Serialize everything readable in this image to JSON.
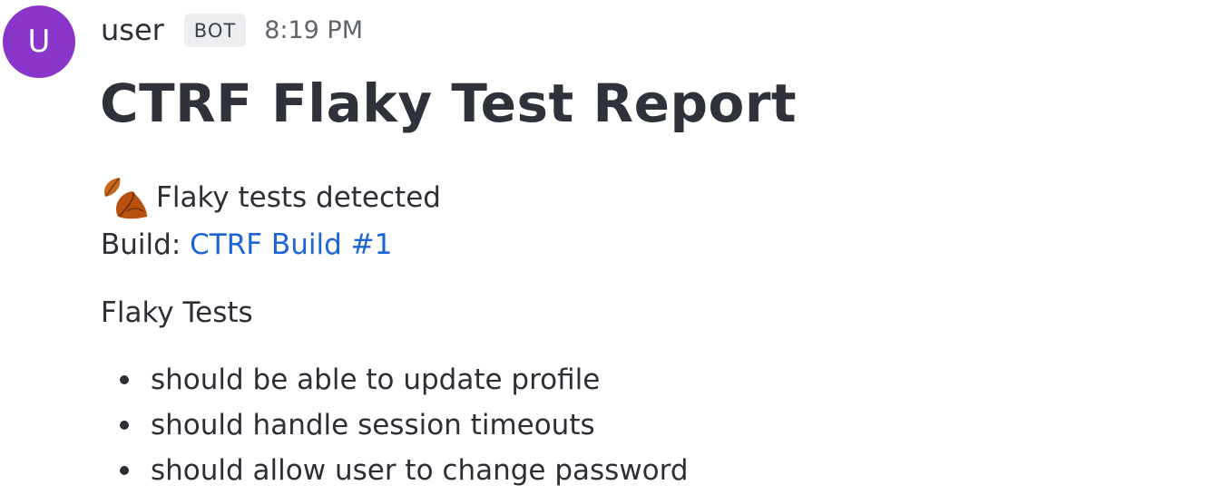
{
  "message": {
    "avatar_initial": "U",
    "avatar_color": "#8a35c9",
    "username": "user",
    "badge": "BOT",
    "timestamp": "8:19 PM"
  },
  "report": {
    "title": "CTRF Flaky Test Report",
    "status_icon": "fallen-leaf-icon",
    "status_text": "Flaky tests detected",
    "build_label": "Build:",
    "build_link_text": "CTRF Build #1",
    "section_heading": "Flaky Tests",
    "tests": [
      "should be able to update profile",
      "should handle session timeouts",
      "should allow user to change password"
    ]
  },
  "colors": {
    "link": "#1d63d8",
    "text": "#2c2f36",
    "badge_bg": "#eceef0"
  }
}
